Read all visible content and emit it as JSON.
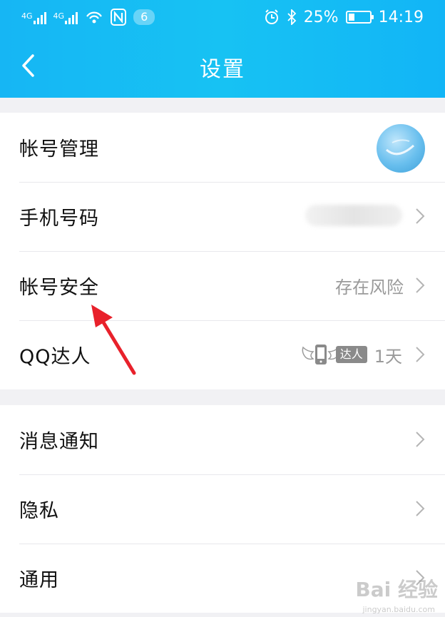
{
  "status_bar": {
    "network_1": "4G",
    "network_2": "4G",
    "notification_count": "6",
    "battery": "25%",
    "time": "14:19"
  },
  "nav": {
    "title": "设置"
  },
  "account_group": [
    {
      "label": "帐号管理"
    },
    {
      "label": "手机号码"
    },
    {
      "label": "帐号安全",
      "value": "存在风险"
    },
    {
      "label": "QQ达人",
      "badge": "达人",
      "value": "1天"
    }
  ],
  "general_group": [
    {
      "label": "消息通知"
    },
    {
      "label": "隐私"
    },
    {
      "label": "通用"
    }
  ],
  "watermark": {
    "text": "Bai 经验",
    "url": "jingyan.baidu.com"
  },
  "colors": {
    "header": "#16b6f4",
    "annotation_arrow": "#e8212b"
  }
}
